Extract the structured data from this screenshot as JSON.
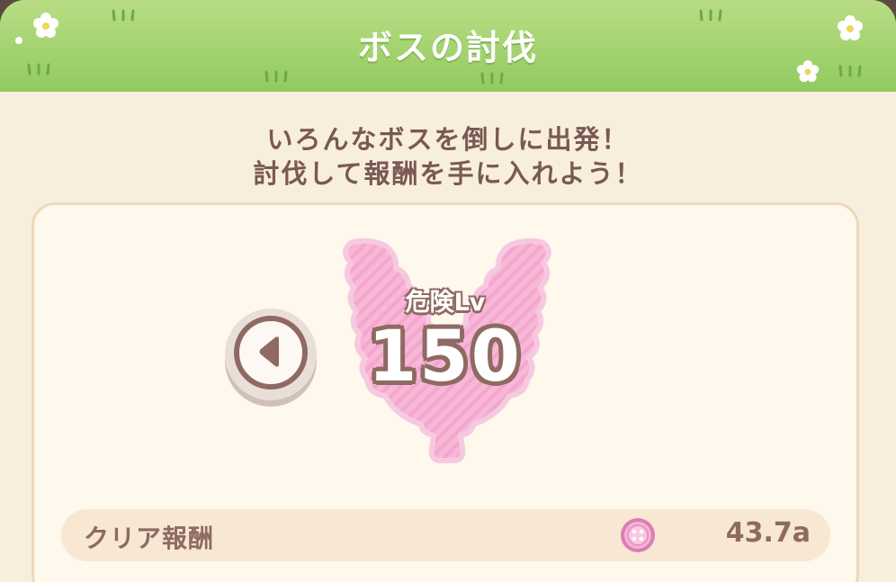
{
  "header": {
    "title": "ボスの討伐"
  },
  "description": {
    "line1": "いろんなボスを倒しに出発！",
    "line2": "討伐して報酬を手に入れよう！"
  },
  "boss": {
    "danger_label": "危険Lv",
    "danger_level": "150"
  },
  "reward": {
    "label": "クリア報酬",
    "value": "43.7a",
    "icon": "button-coin-icon"
  },
  "colors": {
    "header_green": "#92ca60",
    "background": "#f8eedd",
    "text_brown": "#7a5952",
    "emblem_pink": "#f4a9cf"
  }
}
